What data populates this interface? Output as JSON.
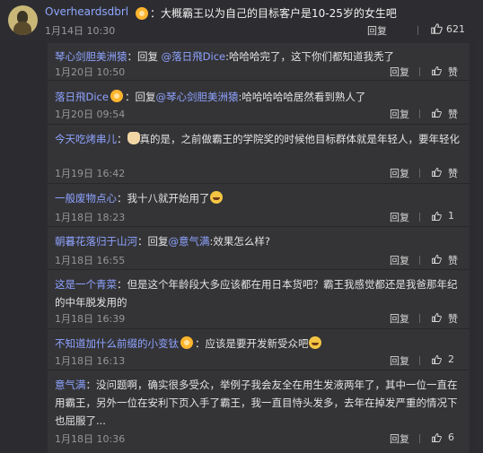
{
  "top_comment": {
    "author": "Overheardsdbrl",
    "text": "：大概霸王以为自己的目标客户是10-25岁的女生吧",
    "time": "1月14日 10:30",
    "reply_label": "回复",
    "like_count": "621",
    "like_icon": "thumbs-up-icon"
  },
  "replies": [
    {
      "author": "琴心剑胆美洲猿",
      "text_prefix": "：回复 ",
      "mention": "@落日飛Dice",
      "text": ":哈哈哈完了，这下你们都知道我秃了",
      "time": "1月20日 10:50",
      "reply_label": "回复",
      "like_label": "赞"
    },
    {
      "author": "落日飛Dice",
      "text_prefix": "：回复",
      "mention": "@琴心剑胆美洲猿",
      "text": ":哈哈哈哈哈居然看到熟人了",
      "time": "1月20日 09:54",
      "reply_label": "回复",
      "like_label": "赞"
    },
    {
      "author": "今天吃烤串儿",
      "text": "真的是，之前做霸王的学院奖的时候他目标群体就是年轻人，要年轻化",
      "time": "1月19日 16:42",
      "reply_label": "回复",
      "like_label": "赞"
    },
    {
      "author": "一般废物点心",
      "text": "：我十八就开始用了",
      "time": "1月18日 18:23",
      "reply_label": "回复",
      "like_label": "1"
    },
    {
      "author": "朝暮花落归于山河",
      "text_prefix": "：回复",
      "mention": "@意气满",
      "text": ":效果怎么样?",
      "time": "1月18日 16:55",
      "reply_label": "回复",
      "like_label": "赞"
    },
    {
      "author": "这是一个青菜",
      "text": "：但是这个年龄段大多应该都在用日本货吧？霸王我感觉都还是我爸那年纪的中年脱发用的",
      "time": "1月18日 16:39",
      "reply_label": "回复",
      "like_label": "赞"
    },
    {
      "author": "不知道加什么前缀的小变钛",
      "text": "：应该是要开发新受众吧",
      "time": "1月18日 16:13",
      "reply_label": "回复",
      "like_label": "2"
    },
    {
      "author": "意气满",
      "text": "：没问题啊，确实很多受众，举例子我会友全在用生发液两年了，其中一位一直在用霸王，另外一位在安利下页入手了霸王，我一直目恃头发多，去年在掉发严重的情况下也屈服了...",
      "time": "1月18日 10:36",
      "reply_label": "回复",
      "like_label": "6"
    }
  ]
}
